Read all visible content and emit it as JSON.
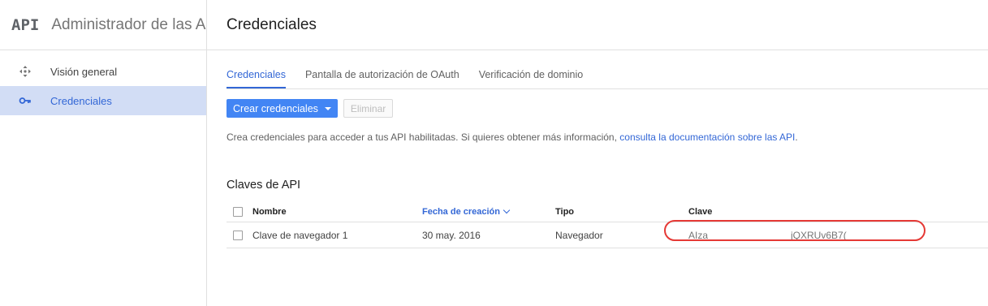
{
  "app": {
    "logo": "API",
    "title": "Administrador de las API"
  },
  "sidebar": {
    "items": [
      {
        "label": "Visión general",
        "icon": "move-arrows-icon",
        "active": false
      },
      {
        "label": "Credenciales",
        "icon": "key-icon",
        "active": true
      }
    ]
  },
  "header": {
    "title": "Credenciales"
  },
  "tabs": [
    {
      "label": "Credenciales",
      "active": true
    },
    {
      "label": "Pantalla de autorización de OAuth",
      "active": false
    },
    {
      "label": "Verificación de dominio",
      "active": false
    }
  ],
  "actions": {
    "create_label": "Crear credenciales",
    "delete_label": "Eliminar"
  },
  "info": {
    "text": "Crea credenciales para acceder a tus API habilitadas. Si quieres obtener más información, ",
    "link": "consulta la documentación sobre las API",
    "suffix": "."
  },
  "api_keys": {
    "title": "Claves de API",
    "columns": {
      "name": "Nombre",
      "created": "Fecha de creación",
      "type": "Tipo",
      "key": "Clave"
    },
    "rows": [
      {
        "name": "Clave de navegador 1",
        "created": "30 may. 2016",
        "type": "Navegador",
        "key_start": "AIza",
        "key_end": "jQXRUv6B7("
      }
    ]
  },
  "colors": {
    "accent": "#3367d6",
    "primary_button": "#4285f4",
    "highlight": "#e53935",
    "active_nav_bg": "#d2ddf5"
  }
}
